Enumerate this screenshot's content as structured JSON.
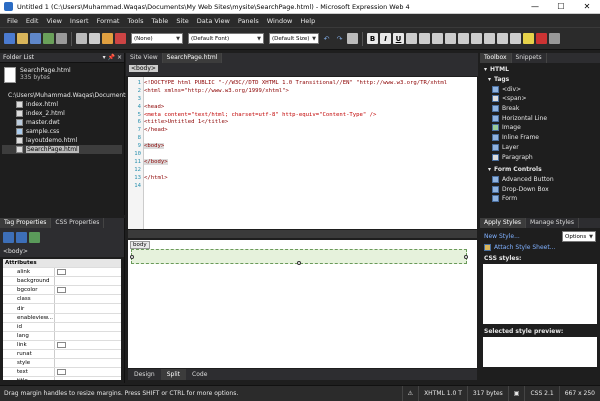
{
  "window": {
    "title": "Untitled 1 (C:\\Users\\Muhammad.Waqas\\Documents\\My Web Sites\\mysite\\SearchPage.html) - Microsoft Expression Web 4"
  },
  "menu": [
    "File",
    "Edit",
    "View",
    "Insert",
    "Format",
    "Tools",
    "Table",
    "Site",
    "Data View",
    "Panels",
    "Window",
    "Help"
  ],
  "toolbar": {
    "style_combo": "(None)",
    "font_combo": "(Default Font)",
    "size_combo": "(Default Size)"
  },
  "folder_list": {
    "title": "Folder List",
    "preview_name": "SearchPage.html",
    "preview_size": "335 bytes",
    "root": "C:\\Users\\Muhammad.Waqas\\Documents\\M",
    "files": [
      "index.html",
      "index_2.html",
      "master.dwt",
      "sample.css",
      "layoutdemo.html",
      "SearchPage.html"
    ]
  },
  "tag_properties": {
    "tabs": [
      "Tag Properties",
      "CSS Properties"
    ],
    "tag": "<body>",
    "section": "Attributes",
    "attributes": [
      "alink",
      "background",
      "bgcolor",
      "class",
      "dir",
      "enableview...",
      "id",
      "lang",
      "link",
      "runat",
      "style",
      "text",
      "title"
    ]
  },
  "editor": {
    "tabs": [
      "Site View",
      "SearchPage.html"
    ],
    "breadcrumb": "<body>",
    "code_lines": [
      {
        "n": "1",
        "text": "<!DOCTYPE html PUBLIC \"-//W3C//DTD XHTML 1.0 Transitional//EN\" \"http://www.w3.org/TR/xhtml"
      },
      {
        "n": "2",
        "text": "<html xmlns=\"http://www.w3.org/1999/xhtml\">"
      },
      {
        "n": "3",
        "text": ""
      },
      {
        "n": "4",
        "text": "<head>"
      },
      {
        "n": "5",
        "text": "<meta content=\"text/html; charset=utf-8\" http-equiv=\"Content-Type\" />"
      },
      {
        "n": "6",
        "text": "<title>Untitled 1</title>"
      },
      {
        "n": "7",
        "text": "</head>"
      },
      {
        "n": "8",
        "text": ""
      },
      {
        "n": "9",
        "text": "<body>"
      },
      {
        "n": "10",
        "text": ""
      },
      {
        "n": "11",
        "text": "</body>"
      },
      {
        "n": "12",
        "text": ""
      },
      {
        "n": "13",
        "text": "</html>"
      },
      {
        "n": "14",
        "text": ""
      }
    ],
    "design_tag": "body",
    "modes": [
      "Design",
      "Split",
      "Code"
    ]
  },
  "toolbox": {
    "tabs": [
      "Toolbox",
      "Snippets"
    ],
    "root": "HTML",
    "groups": [
      {
        "name": "Tags",
        "items": [
          "<div>",
          "<span>",
          "Break",
          "Horizontal Line",
          "Image",
          "Inline Frame",
          "Layer",
          "Paragraph"
        ]
      },
      {
        "name": "Form Controls",
        "items": [
          "Advanced Button",
          "Drop-Down Box",
          "Form"
        ]
      }
    ]
  },
  "apply_styles": {
    "tabs": [
      "Apply Styles",
      "Manage Styles"
    ],
    "new_style": "New Style...",
    "options": "Options",
    "attach": "Attach Style Sheet...",
    "css_styles": "CSS styles:",
    "preview": "Selected style preview:"
  },
  "status": {
    "message": "Drag margin handles to resize margins. Press SHIFT or CTRL for more options.",
    "doctype": "XHTML 1.0 T",
    "size": "317 bytes",
    "css": "CSS 2.1",
    "dims": "667 x 250"
  }
}
